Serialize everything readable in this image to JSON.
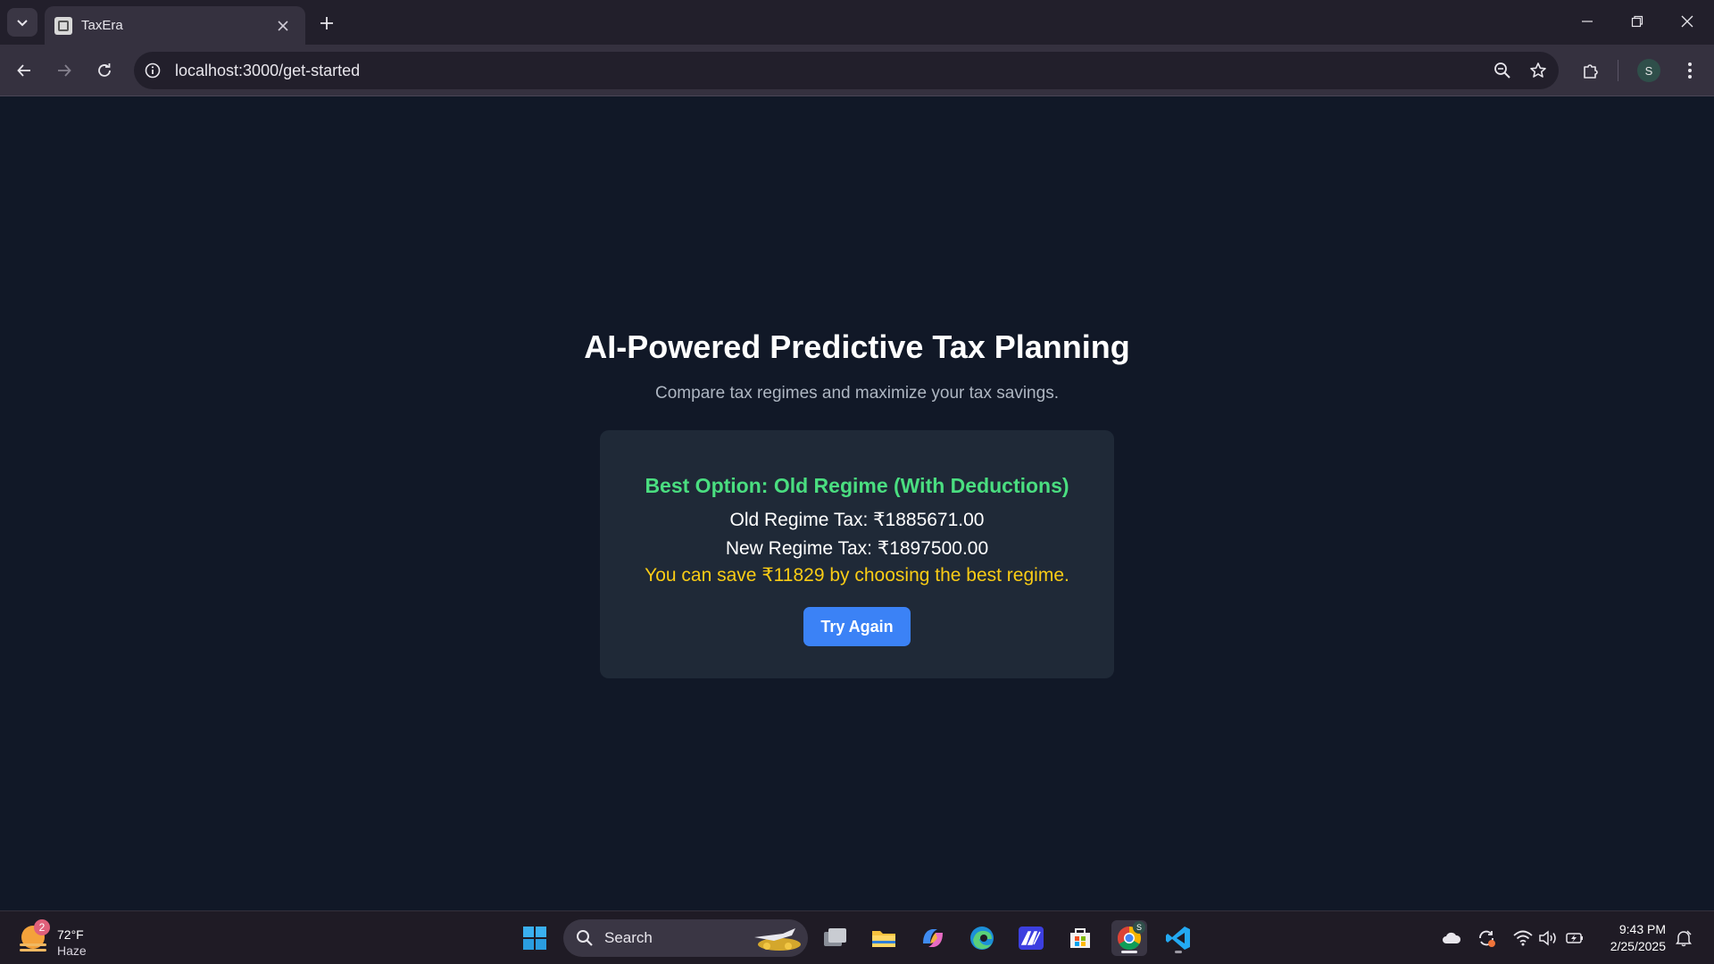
{
  "browser": {
    "tab_title": "TaxEra",
    "url": "localhost:3000/get-started",
    "profile_initial": "S"
  },
  "page": {
    "title": "AI-Powered Predictive Tax Planning",
    "subtitle": "Compare tax regimes and maximize your tax savings.",
    "result": {
      "best_option": "Best Option: Old Regime (With Deductions)",
      "old_regime_tax": "Old Regime Tax: ₹1885671.00",
      "new_regime_tax": "New Regime Tax: ₹1897500.00",
      "savings_message": "You can save ₹11829 by choosing the best regime.",
      "try_again_label": "Try Again"
    }
  },
  "taskbar": {
    "weather": {
      "temp": "72°F",
      "condition": "Haze",
      "badge": "2"
    },
    "search_label": "Search",
    "chrome_badge": "S",
    "clock": {
      "time": "9:43 PM",
      "date": "2/25/2025"
    },
    "apps": [
      "start-icon",
      "search-icon",
      "task-view-icon",
      "file-explorer-icon",
      "copilot-icon",
      "edge-icon",
      "app-icon",
      "microsoft-store-icon",
      "chrome-icon",
      "vscode-icon"
    ]
  },
  "colors": {
    "page_bg": "#111827",
    "card_bg": "#1f2937",
    "best_option": "#4ade80",
    "savings": "#facc15",
    "button": "#3b82f6"
  }
}
